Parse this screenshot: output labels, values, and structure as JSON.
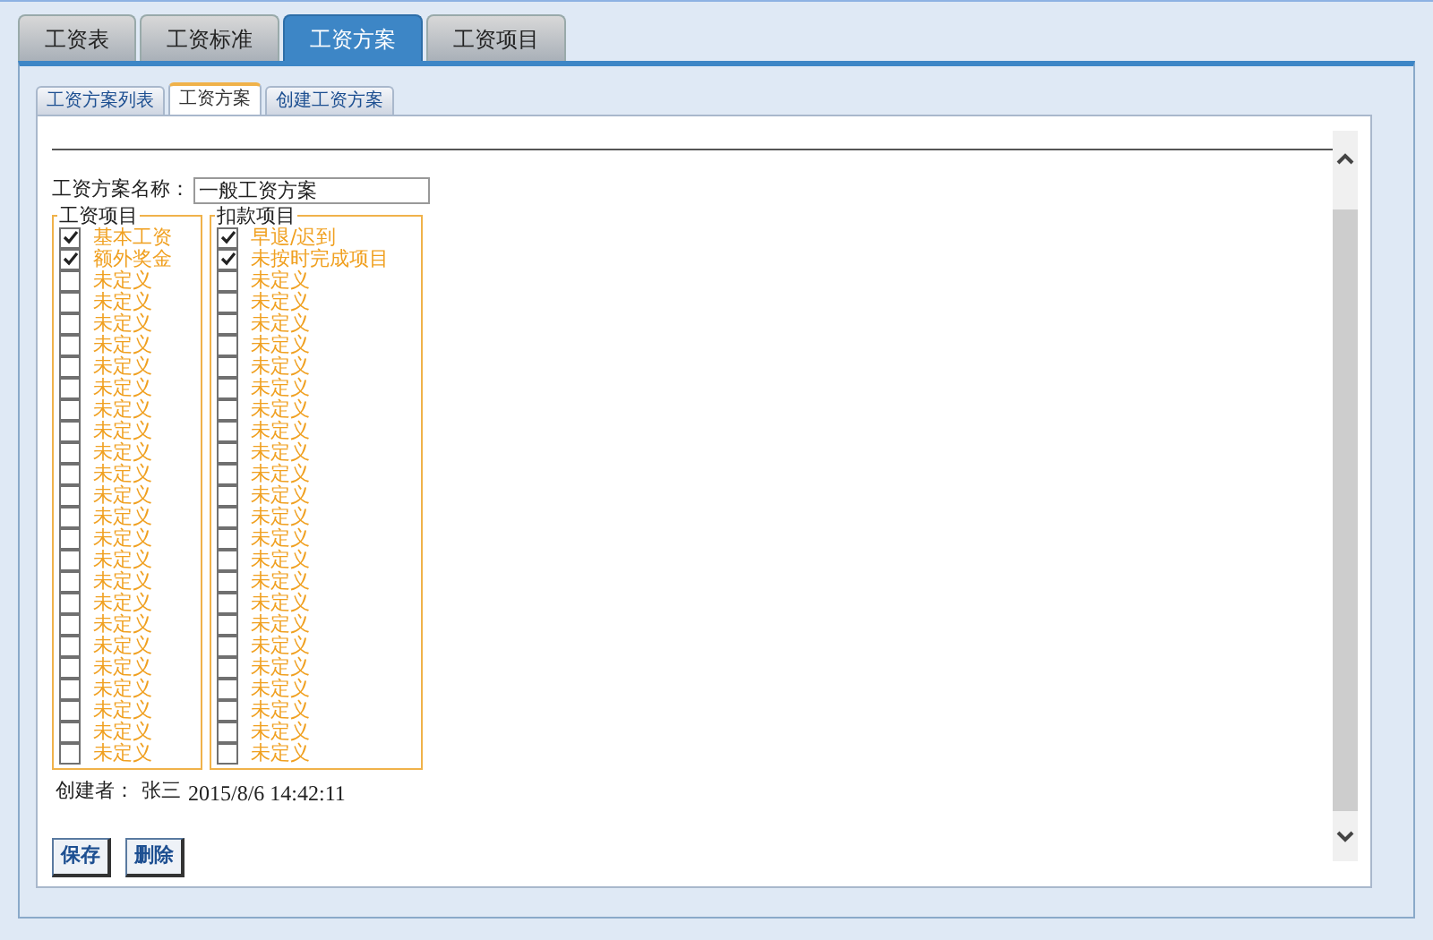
{
  "tabs": [
    {
      "label": "工资表",
      "selected": false
    },
    {
      "label": "工资标准",
      "selected": false
    },
    {
      "label": "工资方案",
      "selected": true
    },
    {
      "label": "工资项目",
      "selected": false
    }
  ],
  "subtabs": [
    {
      "label": "工资方案列表",
      "selected": false
    },
    {
      "label": "工资方案",
      "selected": true
    },
    {
      "label": "创建工资方案",
      "selected": false
    }
  ],
  "form": {
    "name_label": "工资方案名称：",
    "name_value": "一般工资方案"
  },
  "groups": [
    {
      "title": "工资项目",
      "items": [
        {
          "label": "基本工资",
          "checked": true
        },
        {
          "label": "额外奖金",
          "checked": true
        },
        {
          "label": "未定义",
          "checked": false
        },
        {
          "label": "未定义",
          "checked": false
        },
        {
          "label": "未定义",
          "checked": false
        },
        {
          "label": "未定义",
          "checked": false
        },
        {
          "label": "未定义",
          "checked": false
        },
        {
          "label": "未定义",
          "checked": false
        },
        {
          "label": "未定义",
          "checked": false
        },
        {
          "label": "未定义",
          "checked": false
        },
        {
          "label": "未定义",
          "checked": false
        },
        {
          "label": "未定义",
          "checked": false
        },
        {
          "label": "未定义",
          "checked": false
        },
        {
          "label": "未定义",
          "checked": false
        },
        {
          "label": "未定义",
          "checked": false
        },
        {
          "label": "未定义",
          "checked": false
        },
        {
          "label": "未定义",
          "checked": false
        },
        {
          "label": "未定义",
          "checked": false
        },
        {
          "label": "未定义",
          "checked": false
        },
        {
          "label": "未定义",
          "checked": false
        },
        {
          "label": "未定义",
          "checked": false
        },
        {
          "label": "未定义",
          "checked": false
        },
        {
          "label": "未定义",
          "checked": false
        },
        {
          "label": "未定义",
          "checked": false
        },
        {
          "label": "未定义",
          "checked": false
        }
      ]
    },
    {
      "title": "扣款项目",
      "items": [
        {
          "label": "早退/迟到",
          "checked": true
        },
        {
          "label": "未按时完成项目",
          "checked": true
        },
        {
          "label": "未定义",
          "checked": false
        },
        {
          "label": "未定义",
          "checked": false
        },
        {
          "label": "未定义",
          "checked": false
        },
        {
          "label": "未定义",
          "checked": false
        },
        {
          "label": "未定义",
          "checked": false
        },
        {
          "label": "未定义",
          "checked": false
        },
        {
          "label": "未定义",
          "checked": false
        },
        {
          "label": "未定义",
          "checked": false
        },
        {
          "label": "未定义",
          "checked": false
        },
        {
          "label": "未定义",
          "checked": false
        },
        {
          "label": "未定义",
          "checked": false
        },
        {
          "label": "未定义",
          "checked": false
        },
        {
          "label": "未定义",
          "checked": false
        },
        {
          "label": "未定义",
          "checked": false
        },
        {
          "label": "未定义",
          "checked": false
        },
        {
          "label": "未定义",
          "checked": false
        },
        {
          "label": "未定义",
          "checked": false
        },
        {
          "label": "未定义",
          "checked": false
        },
        {
          "label": "未定义",
          "checked": false
        },
        {
          "label": "未定义",
          "checked": false
        },
        {
          "label": "未定义",
          "checked": false
        },
        {
          "label": "未定义",
          "checked": false
        },
        {
          "label": "未定义",
          "checked": false
        }
      ]
    }
  ],
  "creator": {
    "label": "创建者：",
    "name": "张三",
    "time": "2015/8/6 14:42:11"
  },
  "buttons": [
    "保存",
    "删除"
  ]
}
